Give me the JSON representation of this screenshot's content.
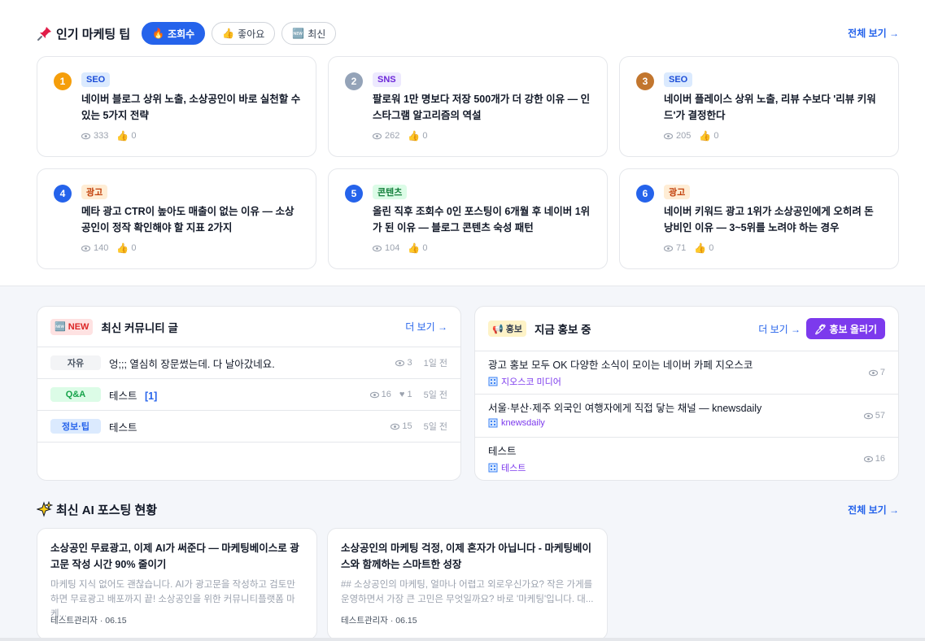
{
  "tips_section": {
    "title": "인기 마케팅 팁",
    "see_all": "전체 보기 →",
    "filters": [
      {
        "label": "조회수",
        "icon": "🔥",
        "active": true
      },
      {
        "label": "좋아요",
        "icon": "👍",
        "active": false
      },
      {
        "label": "최신",
        "icon": "🆕",
        "active": false
      }
    ],
    "cards": [
      {
        "rank": "1",
        "tag": "SEO",
        "title": "네이버 블로그 상위 노출, 소상공인이 바로 실천할 수 있는 5가지 전략",
        "views": "333",
        "likes": "0"
      },
      {
        "rank": "2",
        "tag": "SNS",
        "title": "팔로워 1만 명보다 저장 500개가 더 강한 이유 — 인스타그램 알고리즘의 역설",
        "views": "262",
        "likes": "0"
      },
      {
        "rank": "3",
        "tag": "SEO",
        "title": "네이버 플레이스 상위 노출, 리뷰 수보다 '리뷰 키워드'가 결정한다",
        "views": "205",
        "likes": "0"
      },
      {
        "rank": "4",
        "tag": "광고",
        "title": "메타 광고 CTR이 높아도 매출이 없는 이유 — 소상공인이 정작 확인해야 할 지표 2가지",
        "views": "140",
        "likes": "0"
      },
      {
        "rank": "5",
        "tag": "콘텐츠",
        "title": "올린 직후 조회수 0인 포스팅이 6개월 후 네이버 1위가 된 이유 — 블로그 콘텐츠 숙성 패턴",
        "views": "104",
        "likes": "0"
      },
      {
        "rank": "6",
        "tag": "광고",
        "title": "네이버 키워드 광고 1위가 소상공인에게 오히려 돈 낭비인 이유 — 3~5위를 노려야 하는 경우",
        "views": "71",
        "likes": "0"
      }
    ]
  },
  "community": {
    "badge": "🆕 NEW",
    "title": "최신 커뮤니티 글",
    "more": "더 보기 →",
    "rows": [
      {
        "category": "자유",
        "text": "엉;;; 열심히 장문썼는데. 다 날아갔네요.",
        "count": "",
        "views": "3",
        "likes": "",
        "date": "1일 전"
      },
      {
        "category": "Q&A",
        "text": "테스트",
        "count": "[1]",
        "views": "16",
        "likes": "1",
        "date": "5일 전"
      },
      {
        "category": "정보·팁",
        "text": "테스트",
        "count": "",
        "views": "15",
        "likes": "",
        "date": "5일 전"
      }
    ]
  },
  "promo": {
    "badge": "📢 홍보",
    "title": "지금 홍보 중",
    "more": "더 보기 →",
    "button": "🖊 홍보 올리기",
    "rows": [
      {
        "title": "광고 홍보 모두 OK 다양한 소식이 모이는 네이버 카페 지오스코",
        "source": "지오스코 미디어",
        "views": "7"
      },
      {
        "title": "서울·부산·제주 외국인 여행자에게 직접 닿는 채널 — knewsdaily",
        "source": "knewsdaily",
        "views": "57"
      },
      {
        "title": "테스트",
        "source": "테스트",
        "views": "16"
      }
    ]
  },
  "ai_section": {
    "title": "최신 AI 포스팅 현황",
    "see_all": "전체 보기 →",
    "posts": [
      {
        "title": "소상공인 무료광고, 이제 AI가 써준다 — 마케팅베이스로 광고문 작성 시간 90% 줄이기",
        "excerpt": "마케팅 지식 없어도 괜찮습니다. AI가 광고문을 작성하고 검토만 하면 무료광고 배포까지 끝! 소상공인을 위한 커뮤니티플랫폼 마케...",
        "byline": "테스트관리자 · 06.15"
      },
      {
        "title": "소상공인의 마케팅 걱정, 이제 혼자가 아닙니다 - 마케팅베이스와 함께하는 스마트한 성장",
        "excerpt": "## 소상공인의 마케팅, 얼마나 어렵고 외로우신가요? 작은 가게를 운영하면서 가장 큰 고민은 무엇일까요? 바로 '마케팅'입니다. 대...",
        "byline": "테스트관리자 · 06.15"
      }
    ]
  },
  "colors": {
    "accent": "#2563eb",
    "promo_purple": "#7c3aed",
    "rank_gold": "#f59e0b",
    "rank_silver": "#94a3b8",
    "rank_bronze": "#c2762e",
    "rank_blue": "#2563eb"
  }
}
